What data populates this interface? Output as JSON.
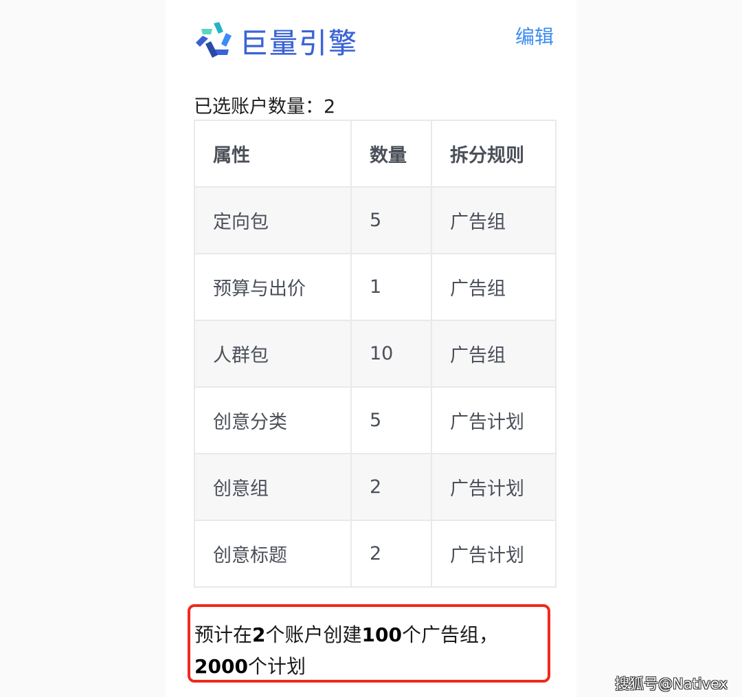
{
  "header": {
    "logo_text": "巨量引擎",
    "edit_label": "编辑"
  },
  "selection": {
    "label": "已选账户数量：",
    "count": "2"
  },
  "table": {
    "columns": [
      "属性",
      "数量",
      "拆分规则"
    ],
    "rows": [
      {
        "attribute": "定向包",
        "quantity": "5",
        "split_rule": "广告组"
      },
      {
        "attribute": "预算与出价",
        "quantity": "1",
        "split_rule": "广告组"
      },
      {
        "attribute": "人群包",
        "quantity": "10",
        "split_rule": "广告组"
      },
      {
        "attribute": "创意分类",
        "quantity": "5",
        "split_rule": "广告计划"
      },
      {
        "attribute": "创意组",
        "quantity": "2",
        "split_rule": "广告计划"
      },
      {
        "attribute": "创意标题",
        "quantity": "2",
        "split_rule": "广告计划"
      }
    ]
  },
  "summary": {
    "part1": "预计在",
    "accounts": "2",
    "part2": "个账户创建",
    "ad_groups": "100",
    "part3": "个广告组，",
    "plans": "2000",
    "part4": "个计划"
  },
  "watermark": "搜狐号@Nativex",
  "colors": {
    "brand_blue": "#3a63d6",
    "link_blue": "#3d8bf2",
    "highlight_red": "#f02a1a"
  }
}
